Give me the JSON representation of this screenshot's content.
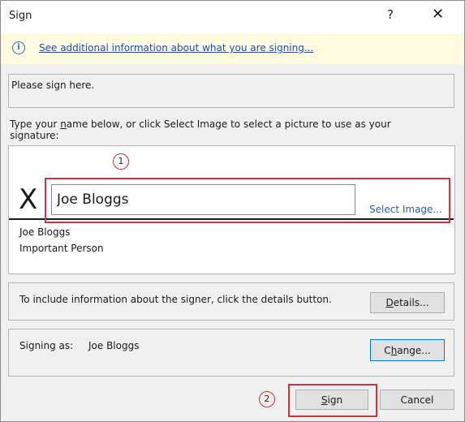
{
  "window": {
    "title": "Sign",
    "help_label": "?",
    "close_label": "✕"
  },
  "infobar": {
    "icon_glyph": "i",
    "link_text": "See additional information about what you are signing..."
  },
  "purpose": {
    "text": "Please sign here."
  },
  "instruction": {
    "before_key": "Type your ",
    "access_key": "n",
    "after_key": "ame below, or click Select Image to select a picture to use as your signature:"
  },
  "signature": {
    "x_mark": "X",
    "name_value": "Joe Bloggs",
    "select_image_label": "Select Image...",
    "signer_name": "Joe Bloggs",
    "signer_title": "Important Person"
  },
  "details": {
    "text": "To include information about the signer, click the details button.",
    "button_key": "D",
    "button_rest": "etails..."
  },
  "signing_as": {
    "label": "Signing as:",
    "name": "Joe Bloggs",
    "change_before": "C",
    "change_key": "h",
    "change_after": "ange..."
  },
  "footer": {
    "sign_key": "S",
    "sign_rest": "ign",
    "cancel_label": "Cancel"
  },
  "annotations": {
    "callout_1": "1",
    "callout_2": "2",
    "highlight_color": "#d0333b"
  }
}
